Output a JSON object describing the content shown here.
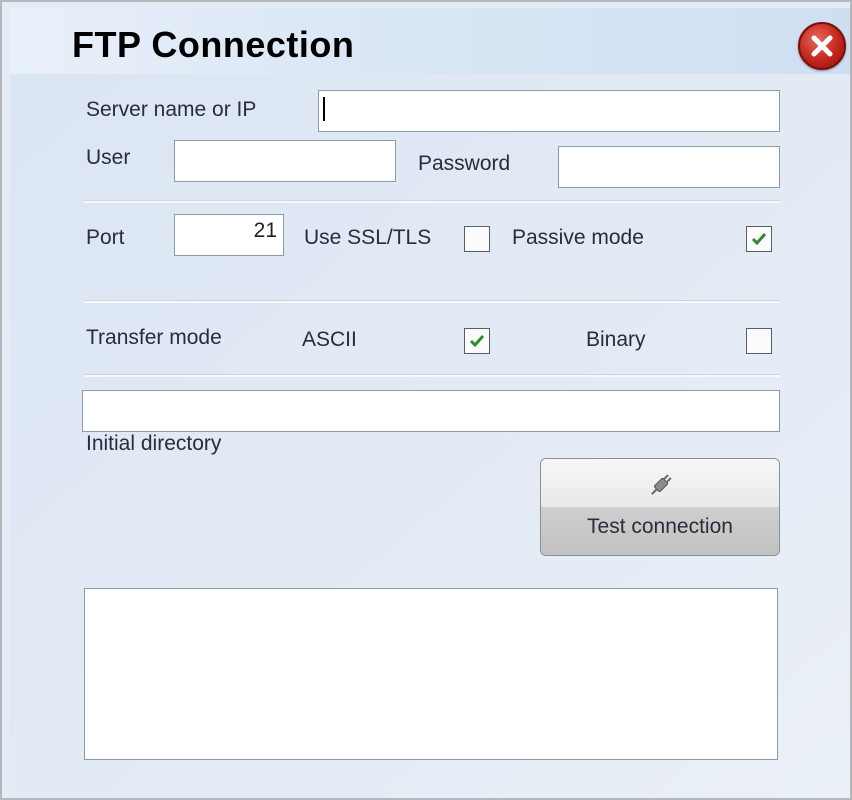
{
  "dialog": {
    "title": "FTP Connection"
  },
  "form": {
    "server_label": "Server name or IP",
    "server_value": "",
    "user_label": "User",
    "user_value": "",
    "password_label": "Password",
    "password_value": "",
    "port_label": "Port",
    "port_value": "21",
    "ssl_label": "Use SSL/TLS",
    "ssl_checked": false,
    "passive_label": "Passive mode",
    "passive_checked": true,
    "transfer_label": "Transfer mode",
    "ascii_label": "ASCII",
    "ascii_checked": true,
    "binary_label": "Binary",
    "binary_checked": false,
    "initial_dir_label": "Initial directory",
    "initial_dir_value": ""
  },
  "actions": {
    "test_label": "Test connection"
  },
  "icons": {
    "close": "close-icon",
    "plug": "plug-icon",
    "check": "checkmark-icon"
  },
  "colors": {
    "check_green": "#2f8a2f",
    "close_red": "#c2251b"
  }
}
